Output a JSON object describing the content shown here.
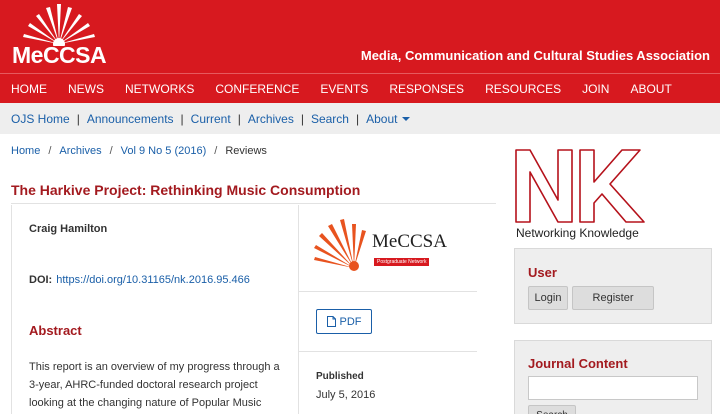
{
  "site": {
    "logo_text": "MeCCSA",
    "association_name": "Media, Communication and Cultural Studies Association"
  },
  "main_nav": [
    "HOME",
    "NEWS",
    "NETWORKS",
    "CONFERENCE",
    "EVENTS",
    "RESPONSES",
    "RESOURCES",
    "JOIN",
    "ABOUT"
  ],
  "sub_nav": {
    "items": [
      "OJS Home",
      "Announcements",
      "Current",
      "Archives",
      "Search",
      "About"
    ],
    "separator": "|"
  },
  "breadcrumb": {
    "items": [
      "Home",
      "Archives",
      "Vol 9 No 5 (2016)",
      "Reviews"
    ],
    "separator": "/"
  },
  "article": {
    "title": "The Harkive Project: Rethinking Music Consumption",
    "author": "Craig Hamilton",
    "doi_label": "DOI:",
    "doi_link": "https://doi.org/10.31165/nk.2016.95.466",
    "abstract_heading": "Abstract",
    "abstract_text": "This report is an overview of my progress through a 3-year, AHRC-funded doctoral research project looking at the changing nature of Popular Music consumption, with emphasis...",
    "journal_logo_text": "MeCCSA",
    "journal_logo_badge": "Postgraduate Network",
    "pdf_label": "PDF",
    "published_label": "Published",
    "published_date": "July 5, 2016"
  },
  "sidebar": {
    "nk_caption": "Networking Knowledge",
    "user_heading": "User",
    "login_label": "Login",
    "register_label": "Register",
    "journal_heading": "Journal Content",
    "search_button_label": "Search"
  },
  "colors": {
    "brand_red": "#d7191f",
    "heading_red": "#a31a1f",
    "link_blue": "#1a5fa8"
  }
}
